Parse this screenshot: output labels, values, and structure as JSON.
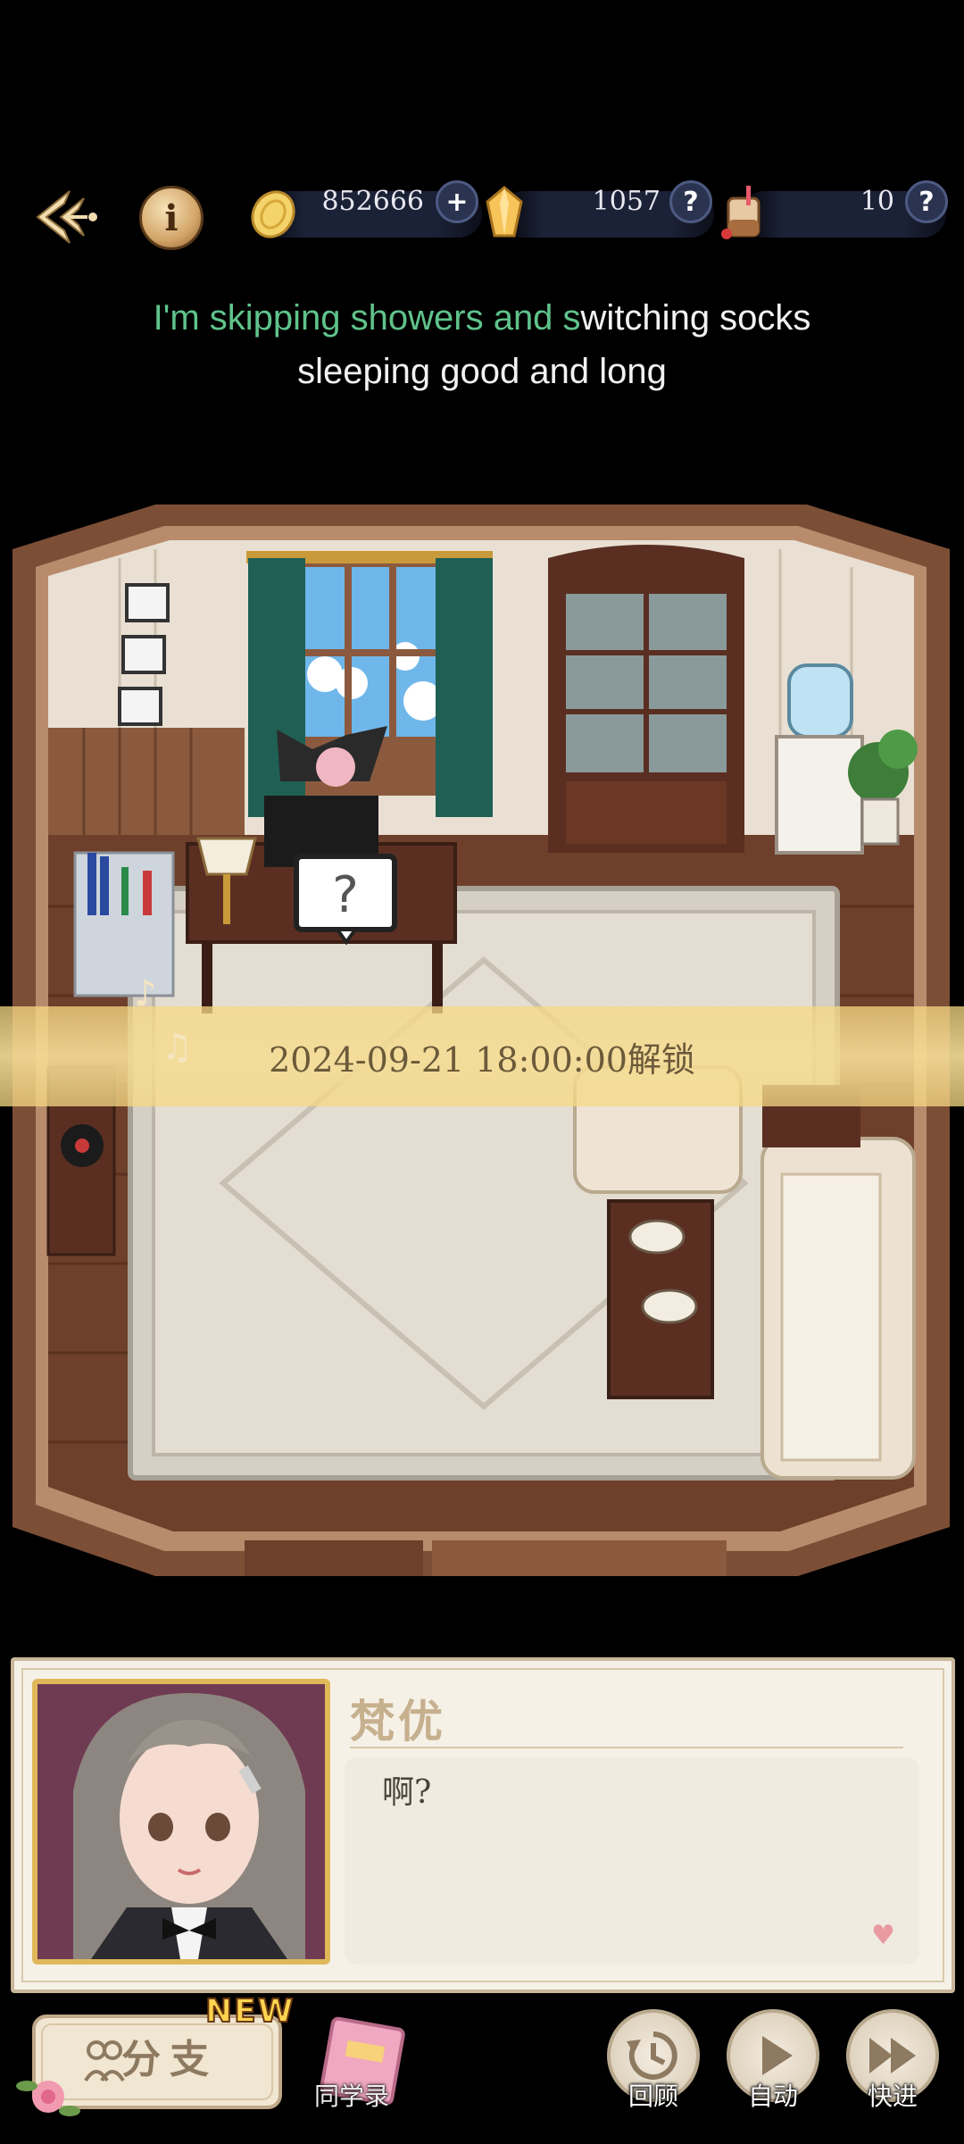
{
  "header": {
    "back_icon": "back-arrow-icon",
    "info_icon": "info-icon",
    "info_glyph": "i",
    "resources": [
      {
        "icon": "gold-coin-icon",
        "value": "852666",
        "button": "+",
        "button_icon": "plus-icon"
      },
      {
        "icon": "crystal-icon",
        "value": "1057",
        "button": "?",
        "button_icon": "help-icon"
      },
      {
        "icon": "milk-tea-icon",
        "value": "10",
        "button": "?",
        "button_icon": "help-icon"
      }
    ]
  },
  "lyric": {
    "line1_sung": "I'm skipping showers and s",
    "line1_unsung": "witching socks",
    "line2": "sleeping good and long"
  },
  "scene": {
    "speech_bubble": "?",
    "unlock_text": "2024-09-21 18:00:00解锁"
  },
  "dialog": {
    "speaker": "梵优",
    "text": "啊?",
    "heart_icon": "heart-icon"
  },
  "bottom": {
    "branch_label": "分支",
    "new_badge": "NEW",
    "classmates_label": "同学录",
    "review_label": "回顾",
    "auto_label": "自动",
    "fast_forward_label": "快进"
  },
  "colors": {
    "sung_lyric": "#5fc38b",
    "banner": "#f5dc96",
    "dialog_bg": "#f6f1e7",
    "speaker_name": "#c6b08e"
  }
}
